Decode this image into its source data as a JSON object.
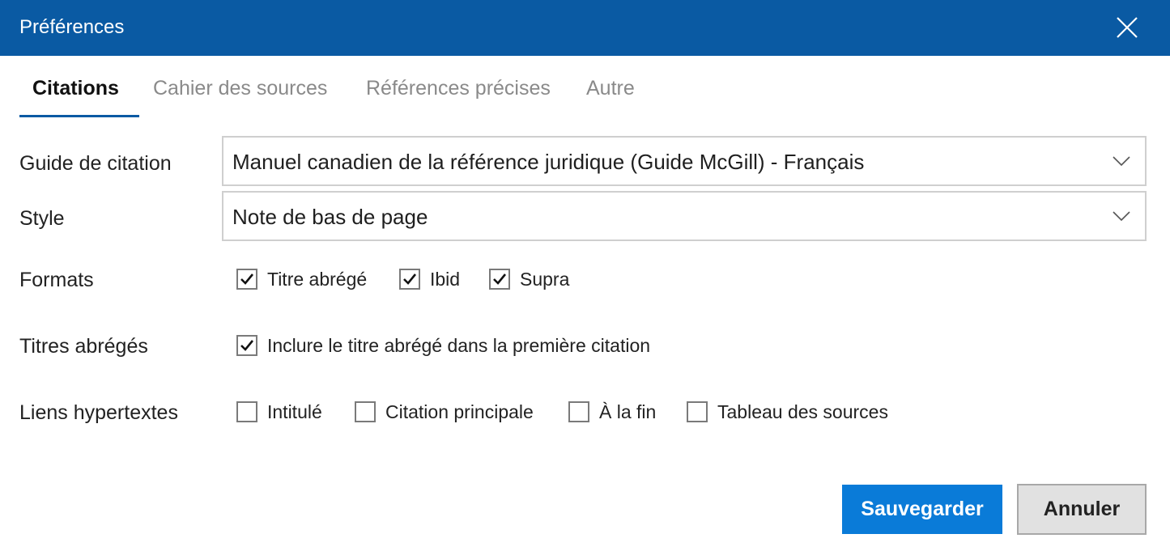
{
  "window": {
    "title": "Préférences"
  },
  "tabs": [
    {
      "label": "Citations",
      "active": true
    },
    {
      "label": "Cahier des sources",
      "active": false
    },
    {
      "label": "Références précises",
      "active": false
    },
    {
      "label": "Autre",
      "active": false
    }
  ],
  "citation_guide": {
    "label": "Guide de citation",
    "value": "Manuel canadien de la référence juridique (Guide McGill) - Français"
  },
  "style": {
    "label": "Style",
    "value": "Note de bas de page"
  },
  "formats": {
    "label": "Formats",
    "options": [
      {
        "label": "Titre abrégé",
        "checked": true
      },
      {
        "label": "Ibid",
        "checked": true
      },
      {
        "label": "Supra",
        "checked": true
      }
    ]
  },
  "short_titles": {
    "label": "Titres abrégés",
    "options": [
      {
        "label": "Inclure le titre abrégé dans la première citation",
        "checked": true
      }
    ]
  },
  "hyperlinks": {
    "label": "Liens hypertextes",
    "options": [
      {
        "label": "Intitulé",
        "checked": false
      },
      {
        "label": "Citation principale",
        "checked": false
      },
      {
        "label": "À la fin",
        "checked": false
      },
      {
        "label": "Tableau des sources",
        "checked": false
      }
    ]
  },
  "buttons": {
    "save": "Sauvegarder",
    "cancel": "Annuler"
  },
  "colors": {
    "titlebar": "#0a5aa3",
    "accent": "#0a7bd8"
  }
}
